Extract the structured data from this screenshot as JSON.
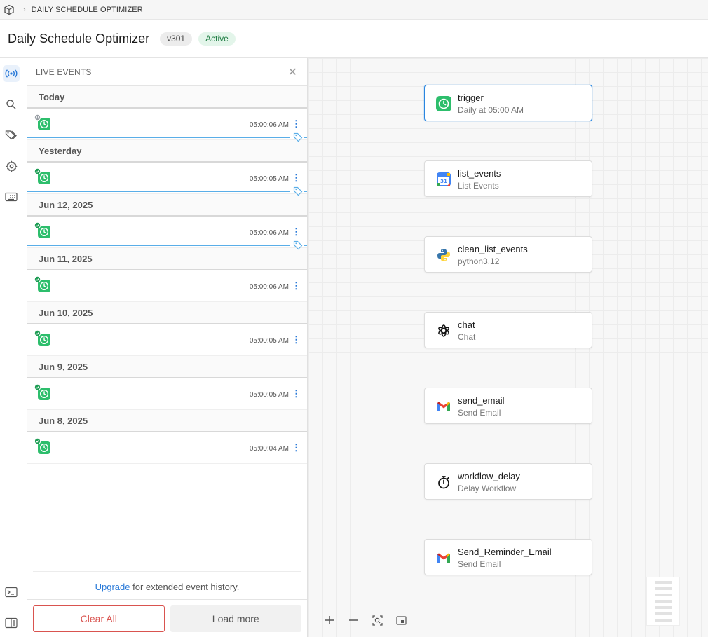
{
  "breadcrumb": {
    "workflow": "DAILY SCHEDULE OPTIMIZER"
  },
  "header": {
    "title": "Daily Schedule Optimizer",
    "version": "v301",
    "status": "Active"
  },
  "panel": {
    "title": "LIVE EVENTS",
    "groups": [
      {
        "label": "Today",
        "events": [
          {
            "time": "05:00:06 AM",
            "state": "paused",
            "tagged": true
          }
        ]
      },
      {
        "label": "Yesterday",
        "events": [
          {
            "time": "05:00:05 AM",
            "state": "success",
            "tagged": true
          }
        ]
      },
      {
        "label": "Jun 12, 2025",
        "events": [
          {
            "time": "05:00:06 AM",
            "state": "success",
            "tagged": true
          }
        ]
      },
      {
        "label": "Jun 11, 2025",
        "events": [
          {
            "time": "05:00:06 AM",
            "state": "success",
            "tagged": false
          }
        ]
      },
      {
        "label": "Jun 10, 2025",
        "events": [
          {
            "time": "05:00:05 AM",
            "state": "success",
            "tagged": false
          }
        ]
      },
      {
        "label": "Jun 9, 2025",
        "events": [
          {
            "time": "05:00:05 AM",
            "state": "success",
            "tagged": false
          }
        ]
      },
      {
        "label": "Jun 8, 2025",
        "events": [
          {
            "time": "05:00:04 AM",
            "state": "success",
            "tagged": false
          }
        ]
      }
    ],
    "footer": {
      "upgrade_link": "Upgrade",
      "upgrade_text": " for extended event history."
    },
    "actions": {
      "clear_all": "Clear All",
      "load_more": "Load more"
    }
  },
  "nodes": [
    {
      "name": "trigger",
      "subtitle": "Daily at 05:00 AM",
      "icon": "clock-icon",
      "selected": true
    },
    {
      "name": "list_events",
      "subtitle": "List Events",
      "icon": "google-calendar-icon"
    },
    {
      "name": "clean_list_events",
      "subtitle": "python3.12",
      "icon": "python-icon"
    },
    {
      "name": "chat",
      "subtitle": "Chat",
      "icon": "openai-icon"
    },
    {
      "name": "send_email",
      "subtitle": "Send Email",
      "icon": "gmail-icon"
    },
    {
      "name": "workflow_delay",
      "subtitle": "Delay Workflow",
      "icon": "stopwatch-icon"
    },
    {
      "name": "Send_Reminder_Email",
      "subtitle": "Send Email",
      "icon": "gmail-icon"
    }
  ],
  "colors": {
    "accent": "#2a86e0",
    "success": "#2dbe6c",
    "danger": "#d9534f",
    "tag_line": "#5aaee8"
  }
}
